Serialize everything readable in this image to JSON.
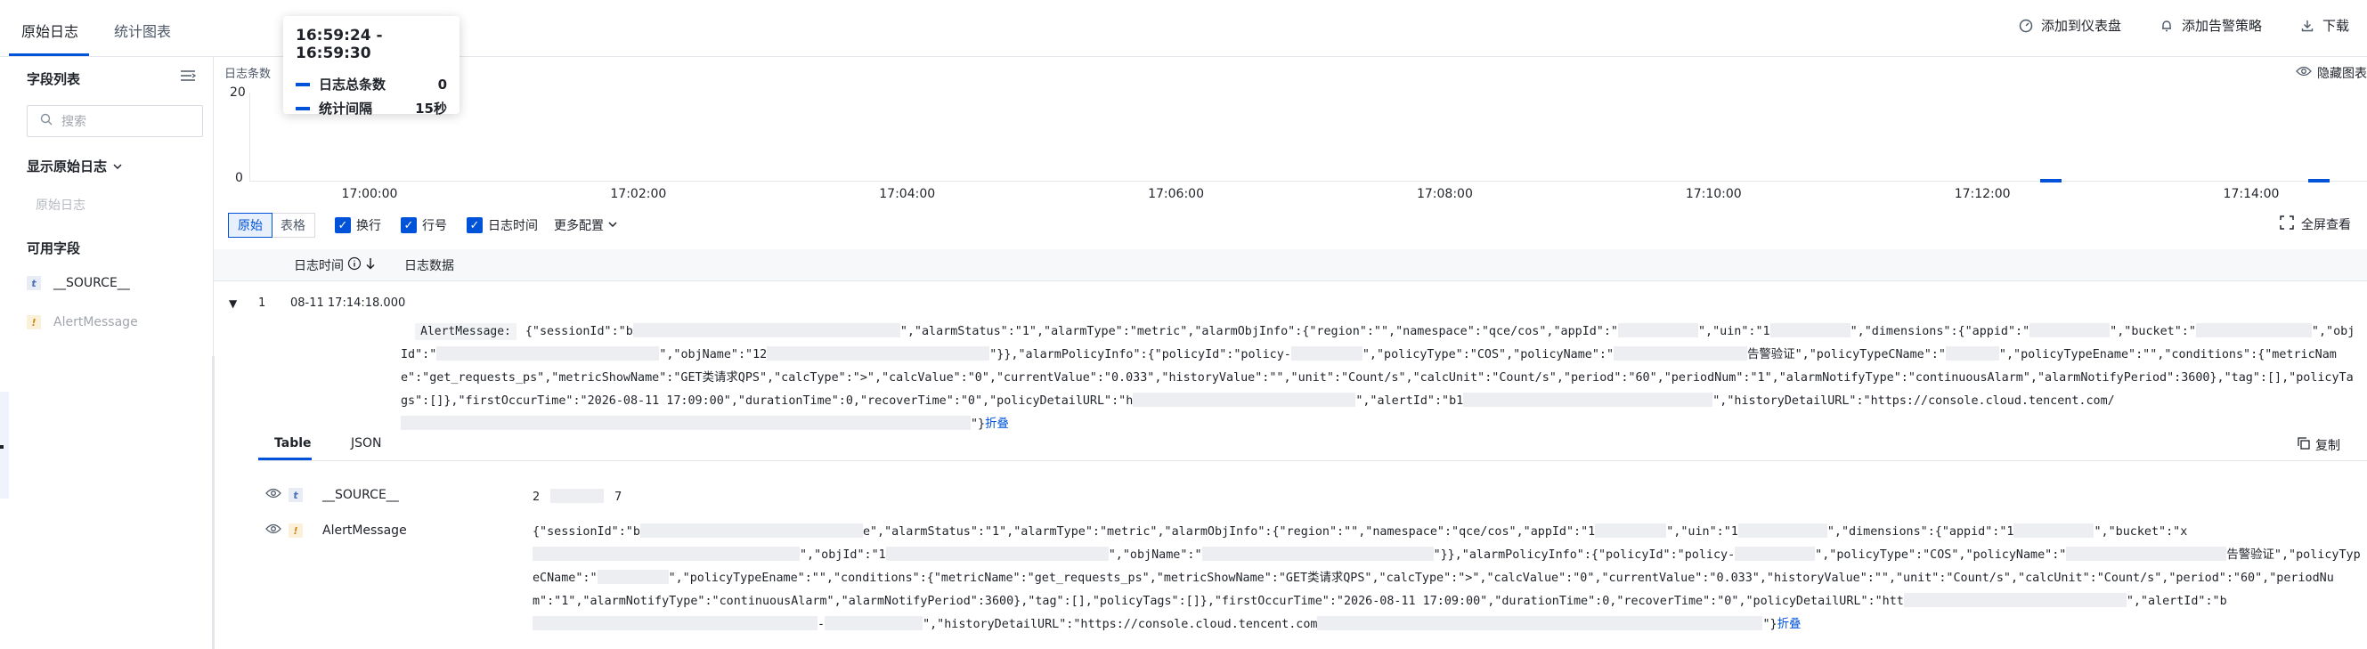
{
  "tabs": [
    {
      "label": "原始日志"
    },
    {
      "label": "统计图表"
    }
  ],
  "top_actions": [
    {
      "label": "添加到仪表盘"
    },
    {
      "label": "添加告警策略"
    },
    {
      "label": "下载"
    }
  ],
  "sidebar": {
    "title": "字段列表",
    "search_placeholder": "搜索",
    "show_raw_label": "显示原始日志",
    "raw_log_item": "原始日志",
    "available_title": "可用字段",
    "fields": [
      {
        "type": "t",
        "name": "__SOURCE__"
      },
      {
        "type": "!",
        "name": "AlertMessage"
      }
    ]
  },
  "chart": {
    "label": "日志条数",
    "hide_label": "隐藏图表",
    "tooltip": {
      "title": "16:59:24 - 16:59:30",
      "rows": [
        {
          "name": "日志总条数",
          "value": "0"
        },
        {
          "name": "统计间隔",
          "value": "15秒"
        }
      ]
    }
  },
  "chart_data": {
    "type": "bar",
    "y_ticks": [
      "20",
      "0"
    ],
    "ylim": [
      0,
      20
    ],
    "x_ticks": [
      "17:00:00",
      "17:02:00",
      "17:04:00",
      "17:06:00",
      "17:08:00",
      "17:10:00",
      "17:12:00",
      "17:14:00"
    ],
    "bars": [
      {
        "time": "17:12:30",
        "value": 1
      },
      {
        "time": "17:14:30",
        "value": 1
      }
    ]
  },
  "toolbar": {
    "view_modes": [
      "原始",
      "表格"
    ],
    "checkboxes": [
      {
        "label": "换行",
        "checked": true
      },
      {
        "label": "行号",
        "checked": true
      },
      {
        "label": "日志时间",
        "checked": true
      }
    ],
    "more_label": "更多配置",
    "fullscreen_label": "全屏查看"
  },
  "table_header": {
    "time_col": "日志时间",
    "data_col": "日志数据"
  },
  "log_row": {
    "index": "1",
    "time": "08-11 17:14:18.000",
    "key": "AlertMessage:",
    "segments": [
      "{\"sessionId\":\"b",
      "\",\"alarmStatus\":\"1\",\"alarmType\":\"metric\",\"alarmObjInfo\":{\"region\":\"\",\"namespace\":\"qce/cos\",\"appId\":\"",
      "\",\"uin\":\"1",
      "\",\"dimensions\":{\"appid\":\"",
      "\",\"bucket\":\"",
      "\",\"objId\":\"",
      "\",\"objName\":\"12",
      "\"}},\"alarmPolicyInfo\":{\"policyId\":\"policy-",
      "\",\"policyType\":\"COS\",\"policyName\":\"",
      "告警验证\",\"policyTypeCName\":\"",
      "\",\"policyTypeEname\":\"\",\"conditions\":{\"metricName\":\"get_requests_ps\",\"metricShowName\":\"GET类请求QPS\",\"calcType\":\">\",\"calcValue\":\"0\",\"currentValue\":\"0.033\",\"historyValue\":\"\",\"unit\":\"Count/s\",\"calcUnit\":\"Count/s\",\"period\":\"60\",\"periodNum\":\"1\",\"alarmNotifyType\":\"continuousAlarm\",\"alarmNotifyPeriod\":3600},\"tag\":[],\"policyTags\":[]},\"firstOccurTime\":\"2026-08-11 17:09:00\",\"durationTime\":0,\"recoverTime\":\"0\",\"policyDetailURL\":\"h",
      "\",\"alertId\":\"b1",
      "\",\"historyDetailURL\":\"https://console.cloud.tencent.com/",
      "\"}"
    ],
    "fold_label": "折叠"
  },
  "detail": {
    "tabs": [
      "Table",
      "JSON"
    ],
    "copy_label": "复制",
    "rows": [
      {
        "type": "t",
        "name": "__SOURCE__",
        "value_start": "2",
        "value_end": "7"
      },
      {
        "type": "!",
        "name": "AlertMessage"
      }
    ],
    "alert_segments": [
      "{\"sessionId\":\"b",
      "e\",\"alarmStatus\":\"1\",\"alarmType\":\"metric\",\"alarmObjInfo\":{\"region\":\"\",\"namespace\":\"qce/cos\",\"appId\":\"1",
      "\",\"uin\":\"1",
      "\",\"dimensions\":{\"appid\":\"1",
      "\",\"bucket\":\"x",
      "\",\"objId\":\"1",
      "\",\"objName\":\"",
      "\"}},\"alarmPolicyInfo\":{\"policyId\":\"policy-",
      "\",\"policyType\":\"COS\",\"policyName\":\"",
      "告警验证\",\"policyTypeCName\":\"",
      "\",\"policyTypeEname\":\"\",\"conditions\":{\"metricName\":\"get_requests_ps\",\"metricShowName\":\"GET类请求QPS\",\"calcType\":\">\",\"calcValue\":\"0\",\"currentValue\":\"0.033\",\"historyValue\":\"\",\"unit\":\"Count/s\",\"calcUnit\":\"Count/s\",\"period\":\"60\",\"periodNum\":\"1\",\"alarmNotifyType\":\"continuousAlarm\",\"alarmNotifyPeriod\":3600},\"tag\":[],\"policyTags\":[]},\"firstOccurTime\":\"2026-08-11 17:09:00\",\"durationTime\":0,\"recoverTime\":\"0\",\"policyDetailURL\":\"htt",
      "\",\"alertId\":\"b",
      "-",
      "\",\"historyDetailURL\":\"https://console.cloud.tencent.com",
      "\"}"
    ]
  }
}
